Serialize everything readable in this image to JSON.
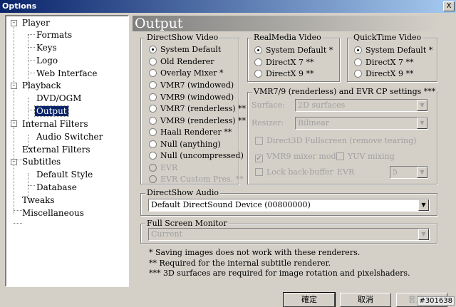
{
  "window": {
    "title": "Options",
    "close_glyph": "X"
  },
  "tree": {
    "items": [
      {
        "label": "Player",
        "expander": "-"
      },
      {
        "label": "Formats"
      },
      {
        "label": "Keys"
      },
      {
        "label": "Logo"
      },
      {
        "label": "Web Interface"
      },
      {
        "label": "Playback",
        "expander": "-"
      },
      {
        "label": "DVD/OGM"
      },
      {
        "label": "Output",
        "selected": true
      },
      {
        "label": "Internal Filters",
        "expander": "-"
      },
      {
        "label": "Audio Switcher"
      },
      {
        "label": "External Filters"
      },
      {
        "label": "Subtitles",
        "expander": "-"
      },
      {
        "label": "Default Style"
      },
      {
        "label": "Database"
      },
      {
        "label": "Tweaks"
      },
      {
        "label": "Miscellaneous"
      }
    ]
  },
  "page": {
    "title": "Output"
  },
  "directshow_video": {
    "title": "DirectShow Video",
    "options": [
      {
        "label": "System Default",
        "checked": true
      },
      {
        "label": "Old Renderer"
      },
      {
        "label": "Overlay Mixer *"
      },
      {
        "label": "VMR7 (windowed)"
      },
      {
        "label": "VMR9 (windowed)"
      },
      {
        "label": "VMR7 (renderless) **"
      },
      {
        "label": "VMR9 (renderless) **"
      },
      {
        "label": "Haali Renderer **"
      },
      {
        "label": "Null (anything)"
      },
      {
        "label": "Null (uncompressed)"
      },
      {
        "label": "EVR",
        "disabled": true
      },
      {
        "label": "EVR Custom Pres. **",
        "disabled": true
      }
    ]
  },
  "realmedia_video": {
    "title": "RealMedia Video",
    "options": [
      {
        "label": "System Default *",
        "checked": true
      },
      {
        "label": "DirectX 7 **"
      },
      {
        "label": "DirectX 9 **"
      }
    ]
  },
  "quicktime_video": {
    "title": "QuickTime Video",
    "options": [
      {
        "label": "System Default *",
        "checked": true
      },
      {
        "label": "DirectX 7 **"
      },
      {
        "label": "DirectX 9 **"
      }
    ]
  },
  "vmr_settings": {
    "title": "VMR7/9 (renderless) and EVR CP settings ***",
    "surface_label": "Surface:",
    "surface_value": "2D surfaces",
    "resizer_label": "Resizer:",
    "resizer_value": "Bilinear",
    "d3d_fullscreen": "Direct3D Fullscreen (remove tearing)",
    "vmr9_mixer": "VMR9 mixer mode",
    "yuv_mixing": "YUV mixing",
    "lock_backbuffer": "Lock back-buffer",
    "evr_label": "EVR",
    "evr_value": "5"
  },
  "directshow_audio": {
    "title": "DirectShow Audio",
    "value": "Default DirectSound Device (00800000)"
  },
  "fullscreen_monitor": {
    "title": "Full Screen Monitor",
    "value": "Current"
  },
  "notes": [
    "* Saving images does not work with these renderers.",
    "** Required for the internal subtitle renderer.",
    "*** 3D surfaces are required for image rotation and pixelshaders."
  ],
  "buttons": {
    "ok": "確定",
    "cancel": "取消",
    "apply": "套用(A)"
  },
  "watermark": "#301638",
  "icons": {
    "dropdown": "triangle-down",
    "check": "check"
  }
}
